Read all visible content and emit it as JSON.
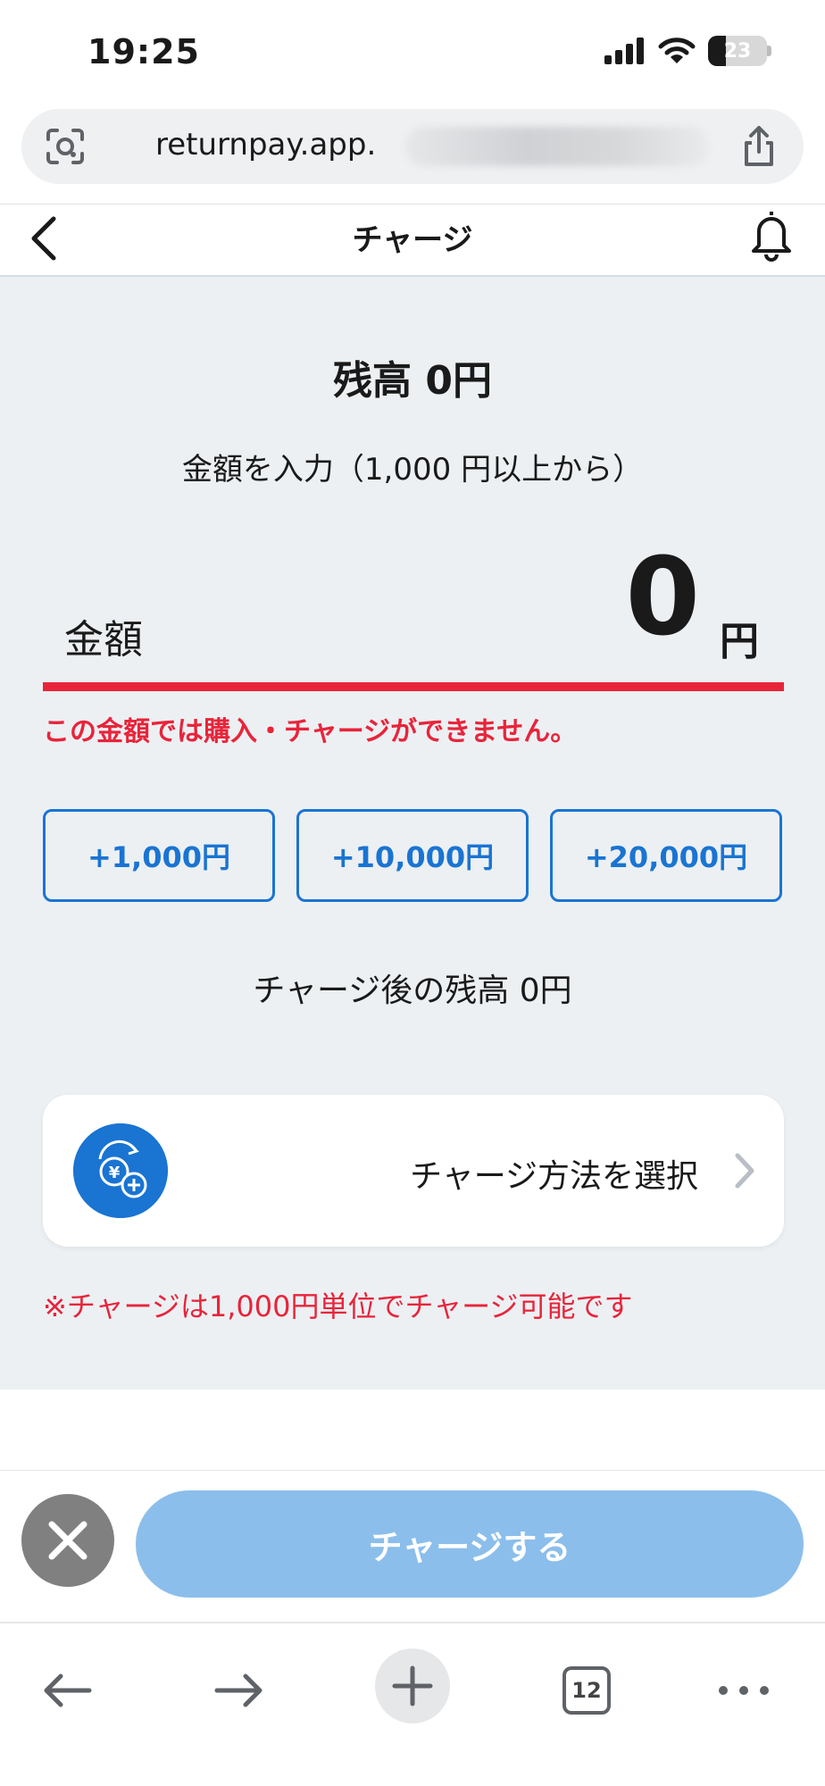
{
  "status_bar": {
    "time": "19:25",
    "battery": "23"
  },
  "browser": {
    "url": "returnpay.app."
  },
  "header": {
    "title": "チャージ"
  },
  "main": {
    "balance": "残高 0円",
    "instruction": "金額を入力（1,000 円以上から）",
    "amount_label": "金額",
    "amount_value": "0",
    "amount_unit": "円",
    "error": "この金額では購入・チャージができません。",
    "quick_buttons": [
      "+1,000円",
      "+10,000円",
      "+20,000円"
    ],
    "after_balance": "チャージ後の残高 0円",
    "method_label": "チャージ方法を選択",
    "note": "※チャージは1,000円単位でチャージ可能です"
  },
  "footer": {
    "charge_button": "チャージする"
  },
  "toolbar": {
    "tab_count": "12"
  },
  "colors": {
    "accent": "#1a74d2",
    "error": "#e8243a",
    "charge_button": "#8bbeeb",
    "panel": "#ecf0f3"
  }
}
